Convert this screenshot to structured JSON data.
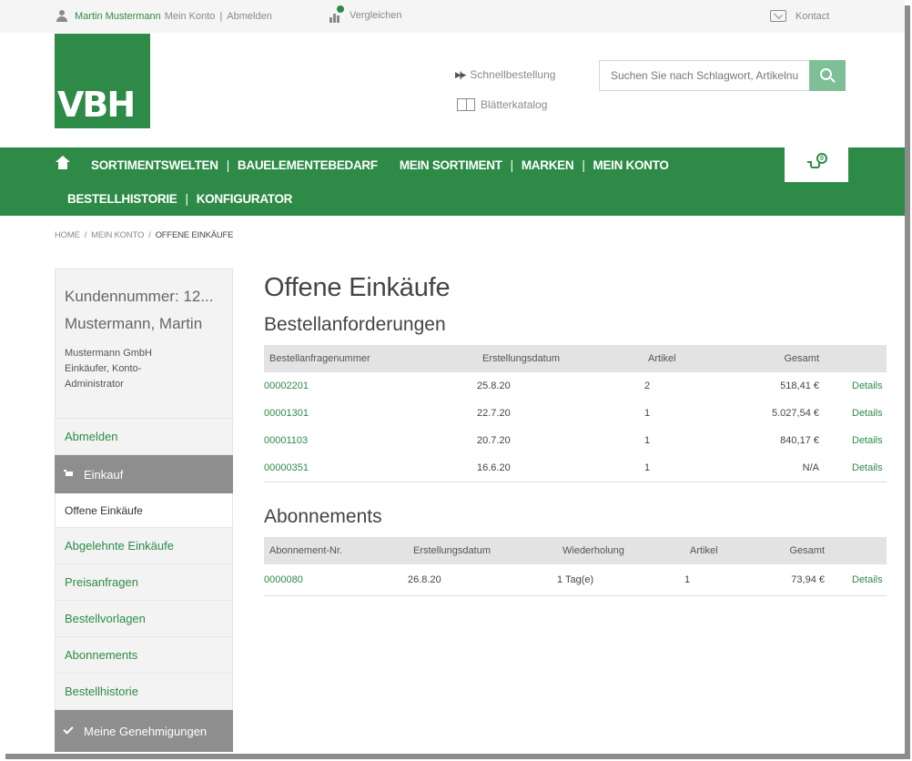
{
  "topbar": {
    "user_name": "Martin Mustermann",
    "my_account": "Mein Konto",
    "separator": "|",
    "logout": "Abmelden",
    "compare": "Vergleichen",
    "contact": "Kontact"
  },
  "header": {
    "logo": "VBH",
    "quick_order": "Schnellbestellung",
    "catalog": "Blätterkatalog",
    "search_placeholder": "Suchen Sie nach Schlagwort, Artikelnu"
  },
  "nav": {
    "row1": [
      "SORTIMENTSWELTEN",
      "BAUELEMENTEBEDARF",
      "MEIN SORTIMENT",
      "MARKEN",
      "MEIN KONTO"
    ],
    "row2": [
      "BESTELLHISTORIE",
      "KONFIGURATOR"
    ],
    "separator": "|",
    "cart_count": "0"
  },
  "breadcrumb": {
    "items": [
      "HOME",
      "MEIN KONTO",
      "OFFENE EINKÄUFE"
    ],
    "separator": "/"
  },
  "sidebar": {
    "customer_number": "Kundennummer: 12...",
    "name": "Mustermann, Martin",
    "company": "Mustermann GmbH",
    "role": "Einkäufer, Konto-Administrator",
    "logout": "Abmelden",
    "section_purchase": "Einkauf",
    "items": [
      "Offene Einkäufe",
      "Abgelehnte Einkäufe",
      "Preisanfragen",
      "Bestellvorlagen",
      "Abonnements",
      "Bestellhistorie"
    ],
    "section_approvals": "Meine Genehmigungen"
  },
  "main": {
    "title": "Offene Einkäufe",
    "requests": {
      "heading": "Bestellanforderungen",
      "columns": [
        "Bestellanfragenummer",
        "Erstellungsdatum",
        "Artikel",
        "Gesamt"
      ],
      "rows": [
        {
          "number": "00002201",
          "date": "25.8.20",
          "items": "2",
          "total": "518,41 €",
          "action": "Details"
        },
        {
          "number": "00001301",
          "date": "22.7.20",
          "items": "1",
          "total": "5.027,54 €",
          "action": "Details"
        },
        {
          "number": "00001103",
          "date": "20.7.20",
          "items": "1",
          "total": "840,17 €",
          "action": "Details"
        },
        {
          "number": "00000351",
          "date": "16.6.20",
          "items": "1",
          "total": "N/A",
          "action": "Details"
        }
      ]
    },
    "subscriptions": {
      "heading": "Abonnements",
      "columns": [
        "Abonnement-Nr.",
        "Erstellungsdatum",
        "Wiederholung",
        "Artikel",
        "Gesamt"
      ],
      "rows": [
        {
          "number": "0000080",
          "date": "26.8.20",
          "repeat": "1 Tag(e)",
          "items": "1",
          "total": "73,94 €",
          "action": "Details"
        }
      ]
    }
  },
  "colors": {
    "brand_green": "#2e8b47",
    "search_button": "#7fbf97",
    "sidebar_section": "#8e8e8e"
  }
}
